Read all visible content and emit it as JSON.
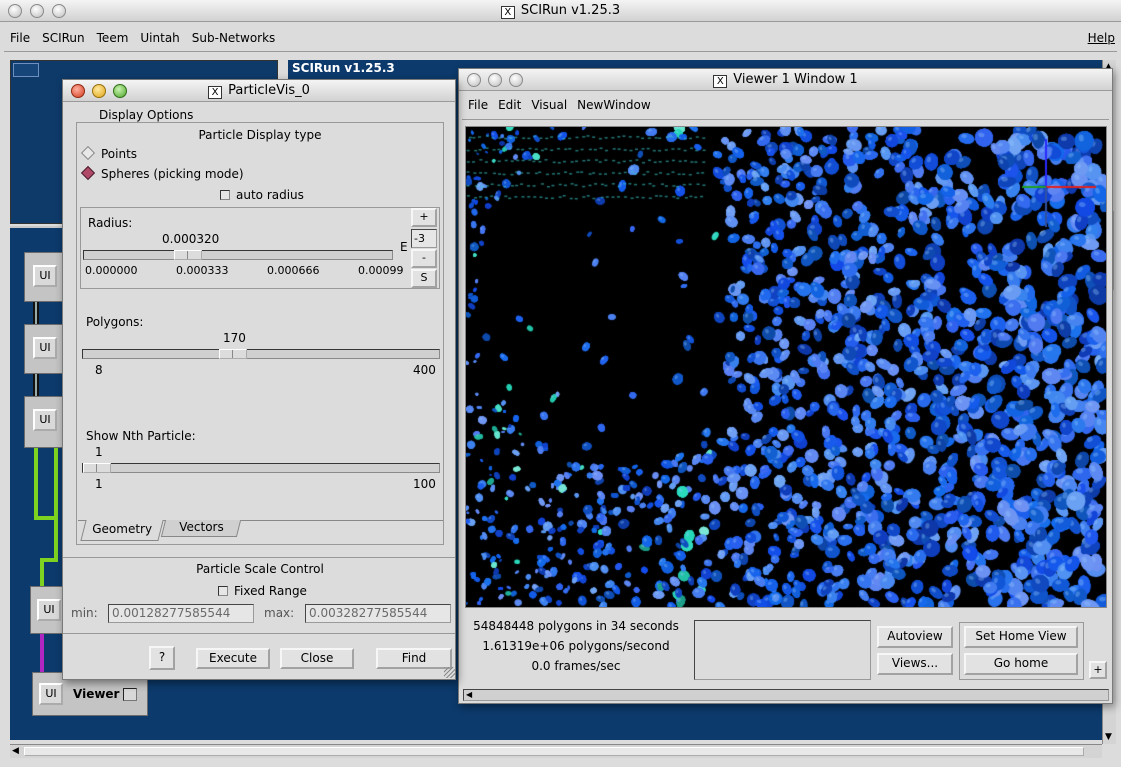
{
  "main_window": {
    "title": "SCIRun v1.25.3",
    "menu": [
      "File",
      "SCIRun",
      "Teem",
      "Uintah",
      "Sub-Networks"
    ],
    "help": "Help",
    "canvas_label": "SCIRun v1.25.3"
  },
  "network": {
    "ui_label": "UI",
    "viewer_label": "Viewer"
  },
  "particlevis": {
    "title": "ParticleVis_0",
    "group_title": "Display Options",
    "display_type_label": "Particle Display type",
    "options": [
      "Points",
      "Spheres (picking mode)"
    ],
    "selected_option": "Spheres (picking mode)",
    "auto_radius": "auto radius",
    "radius": {
      "label": "Radius:",
      "value": "0.000320",
      "ticks": [
        "0.000000",
        "0.000333",
        "0.000666",
        "0.00099"
      ],
      "exp_label": "E",
      "exp_value": "-3",
      "btn_plus": "+",
      "btn_minus": "-",
      "btn_s": "S",
      "fraction": 0.32
    },
    "polygons": {
      "label": "Polygons:",
      "value": "170",
      "min": "8",
      "max": "400",
      "fraction": 0.415
    },
    "nth": {
      "label": "Show Nth Particle:",
      "value": "1",
      "min": "1",
      "max": "100",
      "fraction": 0.0
    },
    "tabs": [
      "Geometry",
      "Vectors"
    ],
    "active_tab": "Geometry",
    "scale_control": {
      "title": "Particle Scale Control",
      "fixed_range": "Fixed Range",
      "min_label": "min:",
      "min_value": "0.00128277585544",
      "max_label": "max:",
      "max_value": "0.00328277585544"
    },
    "buttons": {
      "help": "?",
      "execute": "Execute",
      "close": "Close",
      "find": "Find"
    }
  },
  "viewer": {
    "title": "Viewer 1 Window 1",
    "menu": [
      "File",
      "Edit",
      "Visual",
      "NewWindow"
    ],
    "stats": [
      "54848448 polygons in 34 seconds",
      "1.61319e+06 polygons/second",
      "0.0 frames/sec"
    ],
    "buttons": {
      "autoview": "Autoview",
      "views": "Views...",
      "set_home": "Set Home View",
      "go_home": "Go home",
      "plus": "+"
    },
    "colors": {
      "background": "#000000",
      "particles_dark": "#1a3f9e",
      "particles_light": "#5aa0ff",
      "accent": "#38d0c8"
    }
  },
  "colors": {
    "desktop_blue": "#0d3b6e",
    "network_green": "#7ed321",
    "network_magenta": "#b026c2"
  }
}
